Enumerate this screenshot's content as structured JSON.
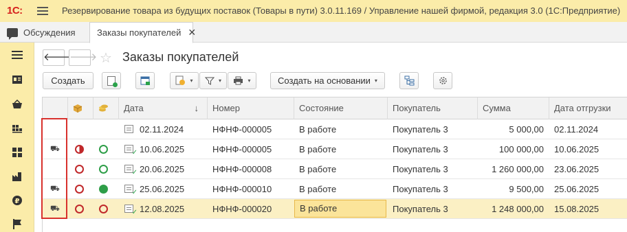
{
  "app": {
    "logo": "1С:",
    "title": "Резервирование товара из будущих поставок (Товары в пути) 3.0.11.169 / Управление нашей фирмой, редакция 3.0  (1С:Предприятие)"
  },
  "tabs": {
    "discussions": "Обсуждения",
    "active": "Заказы покупателей",
    "close": "✕"
  },
  "page": {
    "title": "Заказы покупателей",
    "back": "🡐",
    "forward": "🡒",
    "star": "☆"
  },
  "toolbar": {
    "create": "Создать",
    "create_based_on": "Создать на основании",
    "caret": "▾"
  },
  "table": {
    "columns": [
      "Дата",
      "Номер",
      "Состояние",
      "Покупатель",
      "Сумма",
      "Дата отгрузки"
    ],
    "sort_indicator": "↓",
    "rows": [
      {
        "date": "02.11.2024",
        "number": "НФНФ-000005",
        "state": "В работе",
        "customer": "Покупатель 3",
        "sum": "5 000,00",
        "ship_date": "02.11.2024",
        "reserve": "none",
        "payment": "none",
        "posted": false,
        "truck": false
      },
      {
        "date": "10.06.2025",
        "number": "НФНФ-000005",
        "state": "В работе",
        "customer": "Покупатель 3",
        "sum": "100 000,00",
        "ship_date": "10.06.2025",
        "reserve": "partial",
        "payment": "not-paid",
        "posted": true,
        "truck": true
      },
      {
        "date": "20.06.2025",
        "number": "НФНФ-000008",
        "state": "В работе",
        "customer": "Покупатель 3",
        "sum": "1 260 000,00",
        "ship_date": "23.06.2025",
        "reserve": "not-reserved",
        "payment": "not-paid",
        "posted": true,
        "truck": false
      },
      {
        "date": "25.06.2025",
        "number": "НФНФ-000010",
        "state": "В работе",
        "customer": "Покупатель 3",
        "sum": "9 500,00",
        "ship_date": "25.06.2025",
        "reserve": "not-reserved",
        "payment": "paid",
        "posted": true,
        "truck": true
      },
      {
        "date": "12.08.2025",
        "number": "НФНФ-000020",
        "state": "В работе",
        "customer": "Покупатель 3",
        "sum": "1 248 000,00",
        "ship_date": "15.08.2025",
        "reserve": "not-reserved",
        "payment": "not-paid-red",
        "posted": true,
        "truck": true
      }
    ]
  },
  "colors": {
    "titlebar": "#fbeca9",
    "selected_row": "#fbf0c4",
    "red": "#c0282a",
    "green": "#2e9e48",
    "highlight": "#d8302c"
  }
}
